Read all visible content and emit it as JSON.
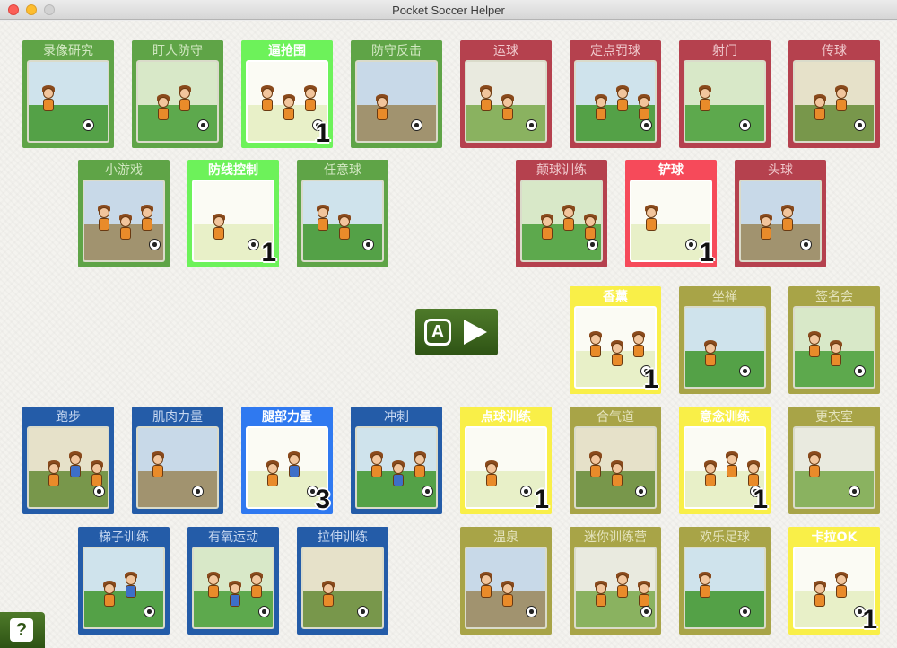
{
  "window": {
    "title": "Pocket Soccer Helper"
  },
  "palette": {
    "green": "#5fa447",
    "green_lbl": "#d2e8c2",
    "green_active": "#6df25a",
    "red": "#b5414e",
    "red_lbl": "#f0c9cd",
    "red_active": "#f64a5a",
    "yellow": "#a8a447",
    "yellow_lbl": "#e4e3bd",
    "yellow_active": "#f9ef48",
    "blue": "#245ca8",
    "blue_lbl": "#c6d7f0",
    "blue_active": "#2f79f0"
  },
  "cards": [
    {
      "label": "录像研究",
      "color": "green",
      "active": false,
      "level": "",
      "icon": "video-study-icon"
    },
    {
      "label": "盯人防守",
      "color": "green",
      "active": false,
      "level": "",
      "icon": "man-marking-icon"
    },
    {
      "label": "逼抢围",
      "color": "green",
      "active": true,
      "level": "1",
      "icon": "pressing-icon"
    },
    {
      "label": "防守反击",
      "color": "green",
      "active": false,
      "level": "",
      "icon": "counter-attack-icon"
    },
    {
      "label": "运球",
      "color": "red",
      "active": false,
      "level": "",
      "icon": "dribble-icon"
    },
    {
      "label": "定点罚球",
      "color": "red",
      "active": false,
      "level": "",
      "icon": "set-piece-icon"
    },
    {
      "label": "射门",
      "color": "red",
      "active": false,
      "level": "",
      "icon": "shooting-icon"
    },
    {
      "label": "传球",
      "color": "red",
      "active": false,
      "level": "",
      "icon": "passing-icon"
    },
    {
      "label": "小游戏",
      "color": "green",
      "active": false,
      "level": "",
      "icon": "mini-game-icon"
    },
    {
      "label": "防线控制",
      "color": "green",
      "active": true,
      "level": "1",
      "icon": "defensive-line-icon"
    },
    {
      "label": "任意球",
      "color": "green",
      "active": false,
      "level": "",
      "icon": "free-kick-icon"
    },
    {
      "label": "颠球训练",
      "color": "red",
      "active": false,
      "level": "",
      "icon": "juggling-icon"
    },
    {
      "label": "铲球",
      "color": "red",
      "active": true,
      "level": "1",
      "icon": "tackle-icon"
    },
    {
      "label": "头球",
      "color": "red",
      "active": false,
      "level": "",
      "icon": "header-icon"
    },
    {
      "label": "香薰",
      "color": "yellow",
      "active": true,
      "level": "1",
      "icon": "aroma-icon"
    },
    {
      "label": "坐禅",
      "color": "yellow",
      "active": false,
      "level": "",
      "icon": "zen-meditation-icon"
    },
    {
      "label": "签名会",
      "color": "yellow",
      "active": false,
      "level": "",
      "icon": "autograph-event-icon"
    },
    {
      "label": "跑步",
      "color": "blue",
      "active": false,
      "level": "",
      "icon": "running-icon"
    },
    {
      "label": "肌肉力量",
      "color": "blue",
      "active": false,
      "level": "",
      "icon": "muscle-strength-icon"
    },
    {
      "label": "腿部力量",
      "color": "blue",
      "active": true,
      "level": "3",
      "icon": "leg-strength-icon"
    },
    {
      "label": "冲刺",
      "color": "blue",
      "active": false,
      "level": "",
      "icon": "sprint-icon"
    },
    {
      "label": "点球训练",
      "color": "yellow",
      "active": true,
      "level": "1",
      "icon": "penalty-training-icon"
    },
    {
      "label": "合气道",
      "color": "yellow",
      "active": false,
      "level": "",
      "icon": "aikido-icon"
    },
    {
      "label": "意念训练",
      "color": "yellow",
      "active": true,
      "level": "1",
      "icon": "mental-training-icon"
    },
    {
      "label": "更衣室",
      "color": "yellow",
      "active": false,
      "level": "",
      "icon": "locker-room-icon"
    },
    {
      "label": "梯子训练",
      "color": "blue",
      "active": false,
      "level": "",
      "icon": "ladder-training-icon"
    },
    {
      "label": "有氧运动",
      "color": "blue",
      "active": false,
      "level": "",
      "icon": "aerobics-icon"
    },
    {
      "label": "拉伸训练",
      "color": "blue",
      "active": false,
      "level": "",
      "icon": "stretching-icon"
    },
    {
      "label": "温泉",
      "color": "yellow",
      "active": false,
      "level": "",
      "icon": "hot-spring-icon"
    },
    {
      "label": "迷你训练营",
      "color": "yellow",
      "active": false,
      "level": "",
      "icon": "mini-camp-icon"
    },
    {
      "label": "欢乐足球",
      "color": "yellow",
      "active": false,
      "level": "",
      "icon": "fun-soccer-icon"
    },
    {
      "label": "卡拉OK",
      "color": "yellow",
      "active": true,
      "level": "1",
      "icon": "karaoke-icon"
    }
  ],
  "play_button": {
    "icon": "a-button-play-icon",
    "letter": "A"
  },
  "help_button": {
    "icon": "help-icon",
    "label": "?"
  }
}
